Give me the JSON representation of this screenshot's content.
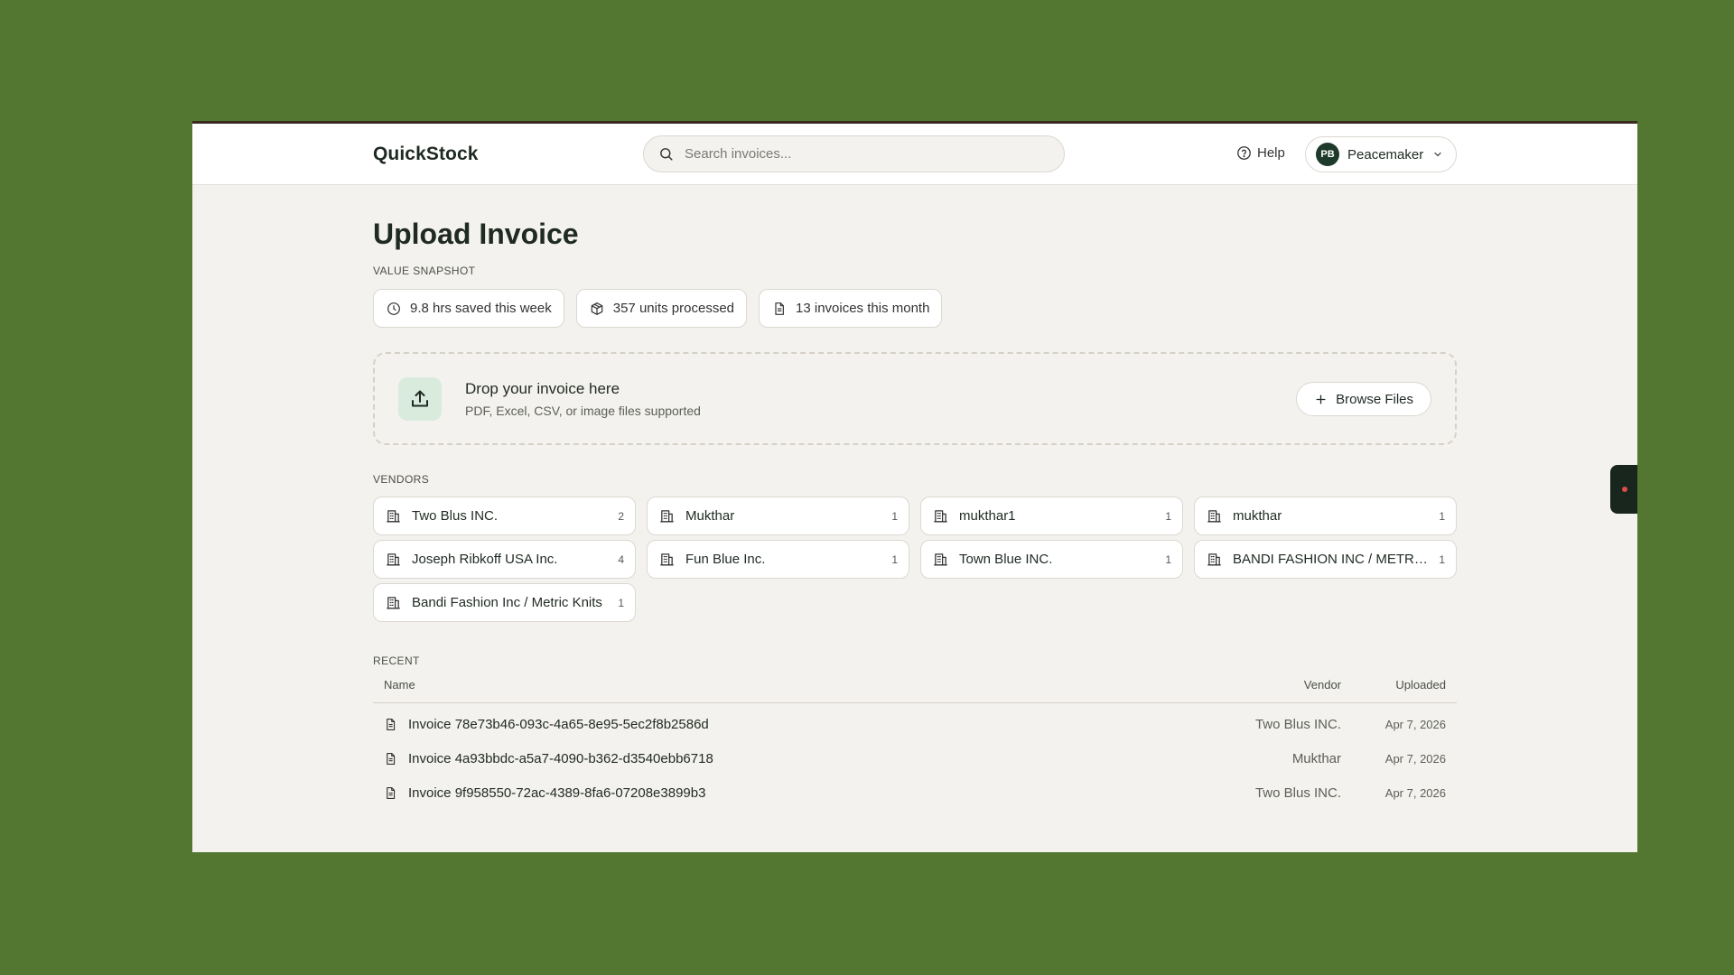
{
  "app": {
    "name": "QuickStock"
  },
  "search": {
    "placeholder": "Search invoices..."
  },
  "header": {
    "help_label": "Help",
    "user": {
      "initials": "PB",
      "name": "Peacemaker"
    }
  },
  "page": {
    "title": "Upload Invoice"
  },
  "snapshot": {
    "label": "VALUE SNAPSHOT",
    "items": [
      {
        "icon": "clock-icon",
        "text": "9.8 hrs saved this week"
      },
      {
        "icon": "box-icon",
        "text": "357 units processed"
      },
      {
        "icon": "document-icon",
        "text": "13 invoices this month"
      }
    ]
  },
  "dropzone": {
    "title": "Drop your invoice here",
    "subtitle": "PDF, Excel, CSV, or image files supported",
    "browse_label": "Browse Files"
  },
  "vendors": {
    "label": "VENDORS",
    "items": [
      {
        "name": "Two Blus INC.",
        "count": "2"
      },
      {
        "name": "Mukthar",
        "count": "1"
      },
      {
        "name": "mukthar1",
        "count": "1"
      },
      {
        "name": "mukthar",
        "count": "1"
      },
      {
        "name": "Joseph Ribkoff USA Inc.",
        "count": "4"
      },
      {
        "name": "Fun Blue Inc.",
        "count": "1"
      },
      {
        "name": "Town Blue INC.",
        "count": "1"
      },
      {
        "name": "BANDI FASHION INC / METRIC ...",
        "count": "1"
      },
      {
        "name": "Bandi Fashion Inc / Metric Knits",
        "count": "1"
      }
    ]
  },
  "recent": {
    "label": "RECENT",
    "columns": {
      "name": "Name",
      "vendor": "Vendor",
      "uploaded": "Uploaded"
    },
    "rows": [
      {
        "name": "Invoice 78e73b46-093c-4a65-8e95-5ec2f8b2586d",
        "vendor": "Two Blus INC.",
        "uploaded": "Apr 7, 2026"
      },
      {
        "name": "Invoice 4a93bbdc-a5a7-4090-b362-d3540ebb6718",
        "vendor": "Mukthar",
        "uploaded": "Apr 7, 2026"
      },
      {
        "name": "Invoice 9f958550-72ac-4389-8fa6-07208e3899b3",
        "vendor": "Two Blus INC.",
        "uploaded": "Apr 7, 2026"
      }
    ]
  },
  "colors": {
    "background": "#537631",
    "surface": "#f4f2ee",
    "accent_dark": "#1e3a2b",
    "upload_tile": "#d8ebdd",
    "side_tab": "#18261e",
    "side_dot": "#e04b4b"
  }
}
